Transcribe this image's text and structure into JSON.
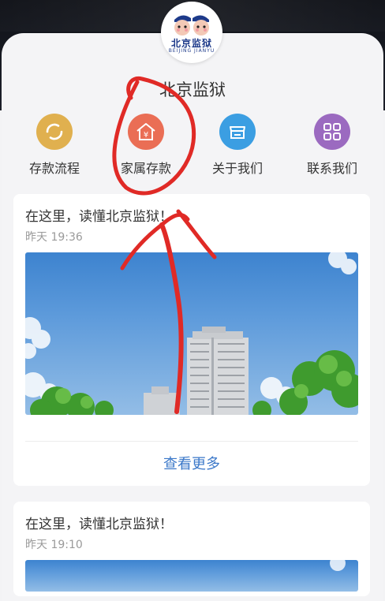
{
  "header": {
    "logo": {
      "text_cn": "北京监狱",
      "text_en": "BEIJING JIANYU"
    },
    "title": "北京监狱"
  },
  "nav": [
    {
      "label": "存款流程",
      "icon": "refresh-circle-icon",
      "color": "#e0b04f"
    },
    {
      "label": "家属存款",
      "icon": "house-yuan-icon",
      "color": "#ea6e55"
    },
    {
      "label": "关于我们",
      "icon": "shop-icon",
      "color": "#3b9ee2"
    },
    {
      "label": "联系我们",
      "icon": "grid-icon",
      "color": "#9b6ac0"
    }
  ],
  "feed": [
    {
      "title": "在这里，读懂北京监狱！",
      "time": "昨天 19:36",
      "more_label": "查看更多",
      "image": "city-building-sky-photo"
    },
    {
      "title": "在这里，读懂北京监狱！",
      "time": "昨天 19:10",
      "image": "city-building-sky-photo"
    }
  ],
  "annotation": {
    "color": "#e02a26",
    "shape": "circle-and-arrow"
  }
}
